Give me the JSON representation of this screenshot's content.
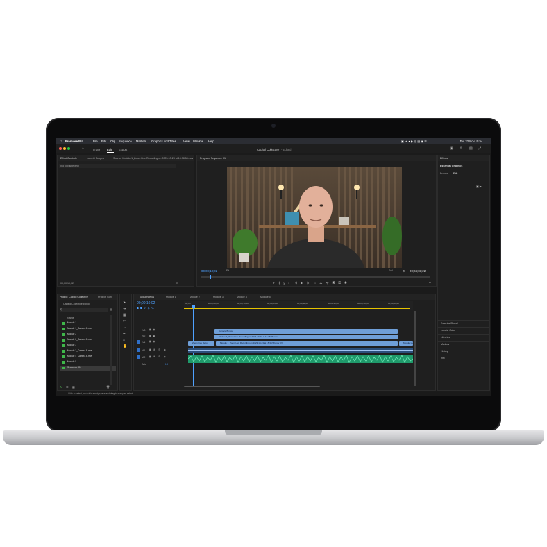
{
  "menubar": {
    "app": "Premiere Pro",
    "items": [
      "File",
      "Edit",
      "Clip",
      "Sequence",
      "Markers",
      "Graphics and Titles",
      "View",
      "Window",
      "Help"
    ],
    "clock": "Thu 22 Nov  15:54"
  },
  "header": {
    "tabs": [
      "Import",
      "Edit",
      "Export"
    ],
    "active_tab": "Edit",
    "project_title": "Capitol Collective",
    "edited_status": "- Edited"
  },
  "effect_controls": {
    "tabs": [
      "Effect Controls",
      "Lumetri Scopes",
      "Source: Module 1_Zoom Live Recording on 2023-10-23 at 15.38.58.mov"
    ],
    "empty_text": "(no clip selected)",
    "timecode": "00;00;10;02"
  },
  "program": {
    "title": "Program: Sequence 01",
    "timecode": "00;00;10;02",
    "fit": "Fit",
    "quality": "Full",
    "duration": "00;04;03;22"
  },
  "project": {
    "tabs": [
      "Project: Capitol Collective",
      "Project: Gurl"
    ],
    "file": "Capitol Collective.prproj",
    "column_name": "Name",
    "items": [
      "Module 1",
      "Module 1_Camera B.mov",
      "Module 2",
      "Module 2_Camera B.mov",
      "Module 3",
      "Module 3_Camera B.mov",
      "Module 4_Camera B.mov",
      "Module 5",
      "Sequence 01"
    ]
  },
  "timeline": {
    "tabs": [
      "Sequence 01",
      "Module 1",
      "Module 2",
      "Module 3",
      "Module 4",
      "Module 5"
    ],
    "timecode": "00;00;10;02",
    "ruler": [
      "00;00",
      "00;00;08;00",
      "00;00;16;00",
      "00;00;24;00",
      "00;00;32;00",
      "00;00;40;00",
      "00;00;48;00",
      "00;00;56;00",
      "00;01;04;00"
    ],
    "tracks": [
      "V3",
      "V2",
      "V1",
      "A1",
      "A2",
      "Mix"
    ],
    "mix_value": "0.0",
    "clips": {
      "v3": "Camera B.mov",
      "v2": "Module 1_Zoom Live Recording on 2023-10-23 at 15.38.58.mov",
      "v1a": "Zoom Live Reco",
      "v1b": "Module 1_Zoom Live Recording on 2023-10-23 at 15.38.58.mov [V]",
      "v1c": "Module Live"
    }
  },
  "right_panel": {
    "title": "Effects",
    "section": "Essential Graphics",
    "tabs": [
      "Browse",
      "Edit"
    ],
    "items": [
      "Essential Sound",
      "Lumetri Color",
      "Libraries",
      "Markers",
      "History",
      "Info"
    ]
  },
  "status_bar": {
    "message": "Click to select, or click in empty space and drag to marquee select."
  }
}
